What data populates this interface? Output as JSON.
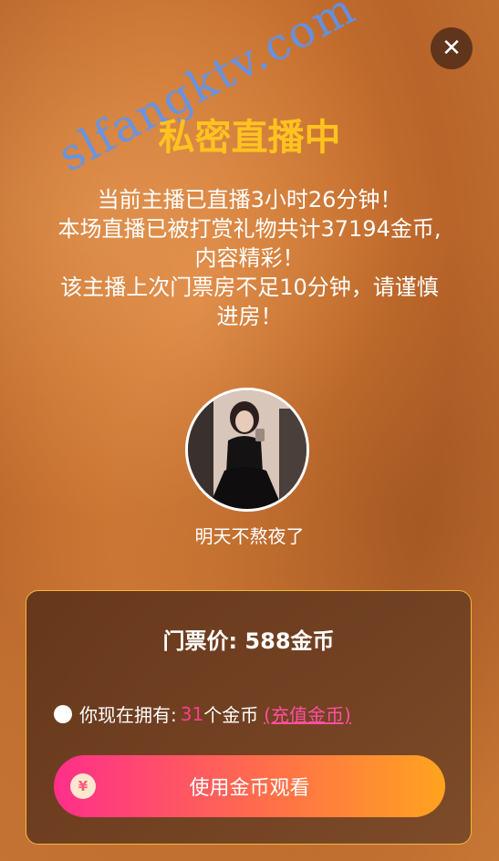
{
  "watermark": "slfangktv.com",
  "close_icon": "close-icon",
  "title": "私密直播中",
  "description": [
    "当前主播已直播3小时26分钟！",
    "本场直播已被打赏礼物共计37194金币,",
    "内容精彩！",
    "该主播上次门票房不足10分钟，请谨慎",
    "进房！"
  ],
  "streamer": {
    "nickname": "明天不熬夜了"
  },
  "ticket": {
    "price_label": "门票价:",
    "price_value": "588金币",
    "balance_prefix": "你现在拥有:",
    "coin_count": "31",
    "coin_unit": "个金币",
    "recharge_label": "(充值金币)",
    "coin_symbol": "¥",
    "watch_button_label": "使用金币观看"
  },
  "colors": {
    "title": "#ffc21f",
    "accent_pink": "#ff3b8d",
    "button_start": "#ff2f8a",
    "button_end": "#ffa31f"
  }
}
